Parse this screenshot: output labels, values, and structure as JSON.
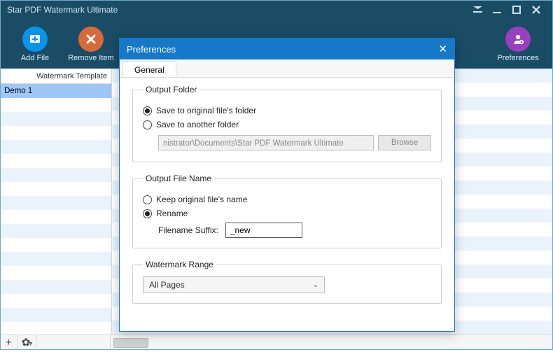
{
  "app": {
    "title": "Star PDF Watermark Ultimate"
  },
  "toolbar": {
    "add_file": "Add File",
    "remove_item": "Remove Item",
    "preferences": "Preferences"
  },
  "sidebar": {
    "header": "Watermark Template",
    "items": [
      {
        "label": "Demo 1",
        "selected": true
      }
    ]
  },
  "dialog": {
    "title": "Preferences",
    "tabs": [
      {
        "label": "General"
      }
    ],
    "output_folder": {
      "legend": "Output Folder",
      "opt_original": "Save to original file's folder",
      "opt_other": "Save to another folder",
      "path": "nistrator\\Documents\\Star PDF Watermark Ultimate",
      "browse": "Browse"
    },
    "output_file": {
      "legend": "Output File Name",
      "opt_keep": "Keep original file's name",
      "opt_rename": "Rename",
      "suffix_label": "Filename Suffix:",
      "suffix_value": "_new"
    },
    "range": {
      "legend": "Watermark Range",
      "value": "All Pages"
    }
  }
}
